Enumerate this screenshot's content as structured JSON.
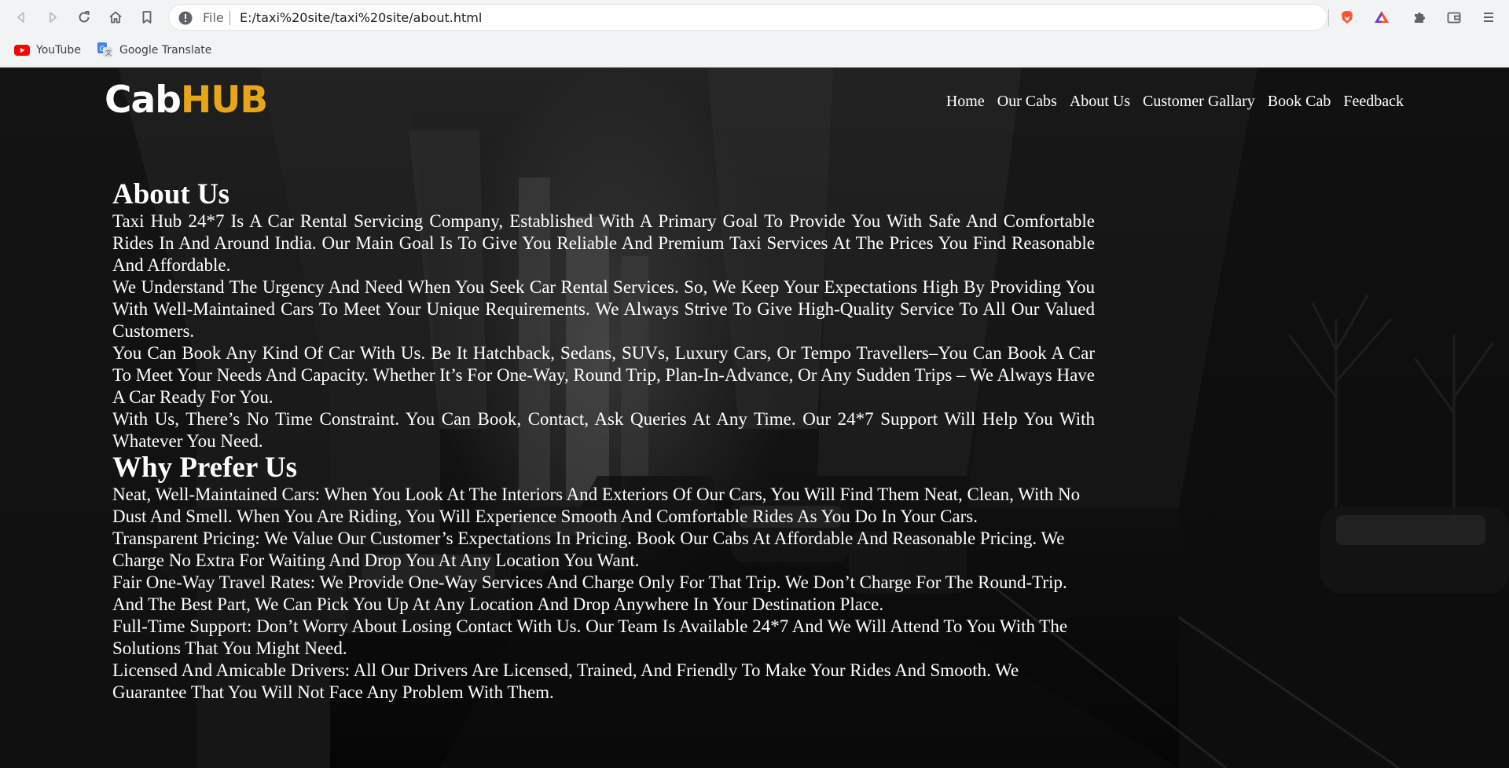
{
  "browser": {
    "address_scheme": "File",
    "address_url": "E:/taxi%20site/taxi%20site/about.html",
    "bookmarks": [
      {
        "label": "YouTube",
        "icon": "youtube-icon"
      },
      {
        "label": "Google Translate",
        "icon": "google-translate-icon"
      }
    ],
    "colors": {
      "youtube_red": "#ff0000",
      "brave_orange": "#fb542b",
      "google_blue": "#4285f4"
    }
  },
  "site": {
    "logo_part1": "Cab",
    "logo_part2": "HUB",
    "colors": {
      "logo_accent": "#e8a515",
      "text": "#ffffff"
    },
    "nav": [
      "Home",
      "Our Cabs",
      "About Us",
      "Customer Gallary",
      "Book Cab",
      "Feedback"
    ]
  },
  "about": {
    "heading": "About Us",
    "paragraphs": [
      "Taxi Hub 24*7 Is A Car Rental Servicing Company, Established With A Primary Goal To Provide You With Safe And Comfortable Rides In And Around India. Our Main Goal Is To Give You Reliable And Premium Taxi Services At The Prices You Find Reasonable And Affordable.",
      "We Understand The Urgency And Need When You Seek Car Rental Services. So, We Keep Your Expectations High By Providing You With Well-Maintained Cars To Meet Your Unique Requirements. We Always Strive To Give High-Quality Service To All Our Valued Customers.",
      "You Can Book Any Kind Of Car With Us. Be It Hatchback, Sedans, SUVs, Luxury Cars, Or Tempo Travellers–You Can Book A Car To Meet Your Needs And Capacity. Whether It’s For One-Way, Round Trip, Plan-In-Advance, Or Any Sudden Trips – We Always Have A Car Ready For You.",
      "With Us, There’s No Time Constraint. You Can Book, Contact, Ask Queries At Any Time. Our 24*7 Support Will Help You With Whatever You Need."
    ]
  },
  "why": {
    "heading": "Why Prefer Us",
    "paragraphs": [
      "Neat, Well-Maintained Cars: When You Look At The Interiors And Exteriors Of Our Cars, You Will Find Them Neat, Clean, With No Dust And Smell. When You Are Riding, You Will Experience Smooth And Comfortable Rides As You Do In Your Cars.",
      "Transparent Pricing: We Value Our Customer’s Expectations In Pricing. Book Our Cabs At Affordable And Reasonable Pricing. We Charge No Extra For Waiting And Drop You At Any Location You Want.",
      "Fair One-Way Travel Rates: We Provide One-Way Services And Charge Only For That Trip. We Don’t Charge For The Round-Trip. And The Best Part, We Can Pick You Up At Any Location And Drop Anywhere In Your Destination Place.",
      "Full-Time Support: Don’t Worry About Losing Contact With Us. Our Team Is Available 24*7 And We Will Attend To You With The Solutions That You Might Need.",
      "Licensed And Amicable Drivers: All Our Drivers Are Licensed, Trained, And Friendly To Make Your Rides And Smooth. We Guarantee That You Will Not Face Any Problem With Them."
    ]
  }
}
